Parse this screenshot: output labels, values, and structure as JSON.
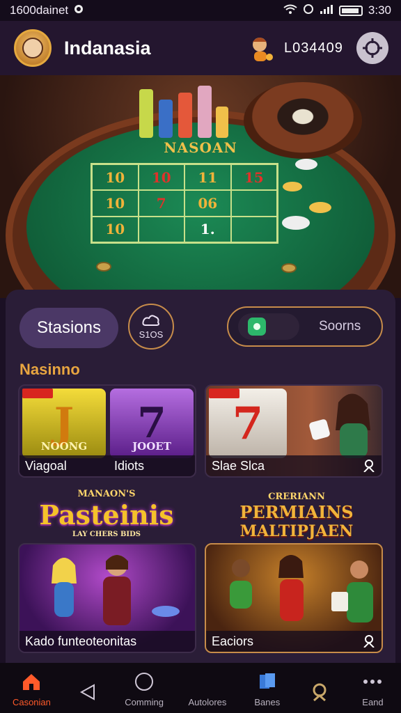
{
  "status_bar": {
    "left_text": "1600dainet",
    "time": "3:30"
  },
  "header": {
    "title": "Indanasia",
    "balance": "L034409"
  },
  "hero": {
    "table_title": "NASOAN",
    "grid_cells": [
      "10",
      "10",
      "11",
      "15",
      "10",
      "7",
      "06",
      "",
      "10",
      "",
      "1.",
      ""
    ]
  },
  "panel": {
    "stations_label": "Stasions",
    "slots_label": "S1OS",
    "search_placeholder": "Soorns",
    "section_title": "Nasinno"
  },
  "cards": [
    {
      "label": "Viagoal",
      "sub": "Idiots",
      "slot1": "J",
      "slot1_sub": "NOONG",
      "slot2": "7",
      "slot2_sub": "JOOET"
    },
    {
      "label": "Slae Slca",
      "slot": "7"
    },
    {
      "label": "Kado funteoteonitas"
    },
    {
      "label": "Eaciors"
    }
  ],
  "promos": [
    {
      "top": "MANAON'S",
      "main": "Pasteinis",
      "sub": "LAY CHERS BIDS"
    },
    {
      "top": "CRERIANN",
      "main": "PERMIAINS",
      "line2": "MALTIPJAEN"
    }
  ],
  "nav": [
    {
      "label": "Casonian",
      "icon": "home-icon",
      "active": true
    },
    {
      "label": "",
      "icon": "back-triangle-icon",
      "active": false
    },
    {
      "label": "Comming",
      "icon": "circle-icon",
      "active": false
    },
    {
      "label": "Autolores",
      "icon": "circle-icon",
      "active": false
    },
    {
      "label": "Banes",
      "icon": "cards-icon",
      "active": false
    },
    {
      "label": "",
      "icon": "search-person-icon",
      "active": false
    },
    {
      "label": "Eand",
      "icon": "more-icon",
      "active": false
    }
  ],
  "colors": {
    "accent": "#e8a540",
    "panel": "#2a1d37",
    "active_nav": "#ff5a2a"
  }
}
